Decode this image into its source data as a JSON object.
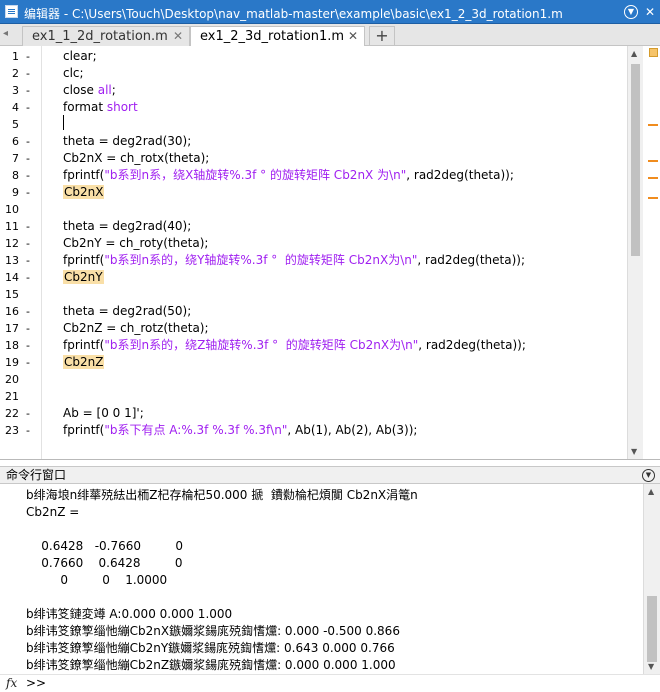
{
  "window": {
    "title": "编辑器 - C:\\Users\\Touch\\Desktop\\nav_matlab-master\\example\\basic\\ex1_2_3d_rotation1.m",
    "menu_glyph": "▼",
    "close_glyph": "✕"
  },
  "tabs": [
    {
      "label": "ex1_1_2d_rotation.m",
      "close": "✕"
    },
    {
      "label": "ex1_2_3d_rotation1.m",
      "close": "✕"
    }
  ],
  "add_tab": "+",
  "editor": {
    "lines": [
      {
        "n": "1",
        "dash": "-",
        "parts": [
          {
            "t": "clear;"
          }
        ]
      },
      {
        "n": "2",
        "dash": "-",
        "parts": [
          {
            "t": "clc;"
          }
        ]
      },
      {
        "n": "3",
        "dash": "-",
        "parts": [
          {
            "t": "close "
          },
          {
            "t": "all",
            "c": "kw-purple"
          },
          {
            "t": ";"
          }
        ]
      },
      {
        "n": "4",
        "dash": "-",
        "parts": [
          {
            "t": "format "
          },
          {
            "t": "short",
            "c": "kw-purple"
          }
        ]
      },
      {
        "n": "5",
        "dash": "",
        "parts": []
      },
      {
        "n": "6",
        "dash": "-",
        "parts": [
          {
            "t": "theta = deg2rad(30);"
          }
        ]
      },
      {
        "n": "7",
        "dash": "-",
        "parts": [
          {
            "t": "Cb2nX = ch_rotx(theta);"
          }
        ]
      },
      {
        "n": "8",
        "dash": "-",
        "parts": [
          {
            "t": "fprintf("
          },
          {
            "t": "\"b系到n系，绕X轴旋转%.3f ° 的旋转矩阵 Cb2nX 为\\n\"",
            "c": "str"
          },
          {
            "t": ", rad2deg(theta));"
          }
        ]
      },
      {
        "n": "9",
        "dash": "-",
        "parts": [
          {
            "t": "Cb2nX",
            "c": "hl"
          }
        ]
      },
      {
        "n": "10",
        "dash": "",
        "parts": []
      },
      {
        "n": "11",
        "dash": "-",
        "parts": [
          {
            "t": "theta = deg2rad(40);"
          }
        ]
      },
      {
        "n": "12",
        "dash": "-",
        "parts": [
          {
            "t": "Cb2nY = ch_roty(theta);"
          }
        ]
      },
      {
        "n": "13",
        "dash": "-",
        "parts": [
          {
            "t": "fprintf("
          },
          {
            "t": "\"b系到n系的，绕Y轴旋转%.3f °  的旋转矩阵 Cb2nX为\\n\"",
            "c": "str"
          },
          {
            "t": ", rad2deg(theta));"
          }
        ]
      },
      {
        "n": "14",
        "dash": "-",
        "parts": [
          {
            "t": "Cb2nY",
            "c": "hl"
          }
        ]
      },
      {
        "n": "15",
        "dash": "",
        "parts": []
      },
      {
        "n": "16",
        "dash": "-",
        "parts": [
          {
            "t": "theta = deg2rad(50);"
          }
        ]
      },
      {
        "n": "17",
        "dash": "-",
        "parts": [
          {
            "t": "Cb2nZ = ch_rotz(theta);"
          }
        ]
      },
      {
        "n": "18",
        "dash": "-",
        "parts": [
          {
            "t": "fprintf("
          },
          {
            "t": "\"b系到n系的，绕Z轴旋转%.3f °  的旋转矩阵 Cb2nX为\\n\"",
            "c": "str"
          },
          {
            "t": ", rad2deg(theta));"
          }
        ]
      },
      {
        "n": "19",
        "dash": "-",
        "parts": [
          {
            "t": "Cb2nZ",
            "c": "hl"
          }
        ]
      },
      {
        "n": "20",
        "dash": "",
        "parts": []
      },
      {
        "n": "21",
        "dash": "",
        "parts": []
      },
      {
        "n": "22",
        "dash": "-",
        "parts": [
          {
            "t": "Ab = [0 0 1]';"
          }
        ]
      },
      {
        "n": "23",
        "dash": "-",
        "parts": [
          {
            "t": "fprintf("
          },
          {
            "t": "\"b系下有点 A:%.3f %.3f %.3f\\n\"",
            "c": "str"
          },
          {
            "t": ", Ab(1), Ab(2), Ab(3));"
          }
        ]
      }
    ]
  },
  "command_window": {
    "title": "命令行窗口",
    "menu_glyph": "▼",
    "output": [
      "b绯海埌n绯蕐殑紶出栭Z杞存棆杞50.000 搋  鐨勬棆杞煩闃 Cb2nX涓篭n",
      "Cb2nZ =",
      "",
      "    0.6428   -0.7660         0",
      "    0.7660    0.6428         0",
      "         0         0    1.0000",
      "",
      "b绯讳笅鏈変竴 A:0.000 0.000 1.000",
      "b绯讳笅鐐箰缁忚繃Cb2nX鏃嬭浆鍚庣殑鍧愭爣: 0.000 -0.500 0.866",
      "b绯讳笅鐐箰缁忚繃Cb2nY鏃嬭浆鍚庣殑鍧愭爣: 0.643 0.000 0.766",
      "b绯讳笅鐐箰缁忚繃Cb2nZ鏃嬭浆鍚庣殑鍧愭爣: 0.000 0.000 1.000"
    ],
    "fx_label": "fx",
    "prompt": ">>"
  }
}
